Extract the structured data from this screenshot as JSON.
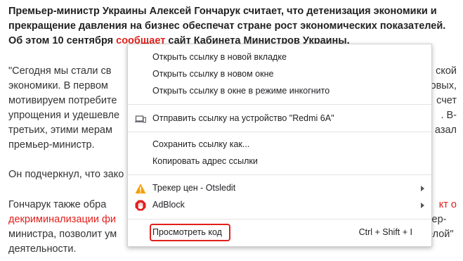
{
  "article": {
    "lines": [
      "Премьер-министр Украины Алексей Гончарук считает, что детенизация экономики и",
      "прекращение давления на бизнес обеспечат стране рост экономических показателей.",
      "Об этом 10 сентября",
      "сообщает",
      "сайт Кабинета Министров Украины.",
      "\"Сегодня мы стали св",
      "ской",
      "экономики. В первом",
      "овых,",
      "мотивируем потребите",
      "счет",
      "упрощения и удешевле",
      ". В-",
      "третьих, этими мерам",
      "азал",
      "премьер-министр.",
      "Он подчеркнул, что зако",
      "Гончарук также обра",
      "кт о",
      "декриминализации фи",
      "ьмер-",
      "министра, позволит ум",
      "елой\"",
      "деятельности."
    ]
  },
  "context_menu": {
    "open_new_tab": "Открыть ссылку в новой вкладке",
    "open_new_window": "Открыть ссылку в новом окне",
    "open_incognito": "Открыть ссылку в окне в режиме инкогнито",
    "send_to_device": "Отправить ссылку на устройство \"Redmi 6A\"",
    "save_link_as": "Сохранить ссылку как...",
    "copy_link_address": "Копировать адрес ссылки",
    "price_tracker": "Трекер цен - Otsledit",
    "adblock": "AdBlock",
    "inspect": "Просмотреть код",
    "inspect_shortcut": "Ctrl + Shift + I"
  },
  "colors": {
    "accent_red": "#e0201b",
    "otsledit_orange": "#f5a000",
    "adblock_red": "#e02020"
  },
  "icons": {
    "send_to_device": "laptop-phone-icon",
    "price_tracker": "warning-triangle-icon",
    "adblock": "adblock-hand-icon",
    "submenu": "chevron-right-icon"
  }
}
